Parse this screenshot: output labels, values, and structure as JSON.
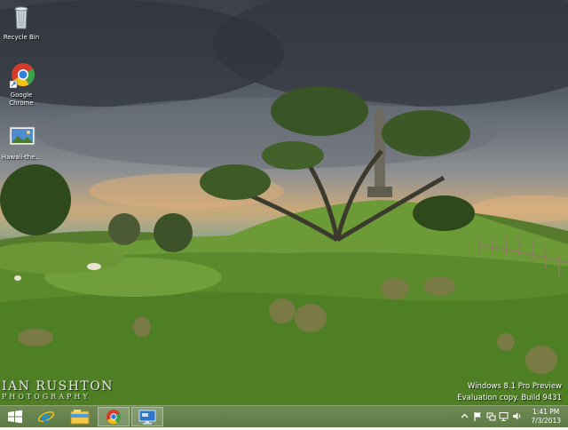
{
  "desktop": {
    "icons": [
      {
        "label": "Recycle Bin",
        "icon": "recycle-bin-icon"
      },
      {
        "label": "Google Chrome",
        "icon": "chrome-icon"
      },
      {
        "label": "Hawaii-the...",
        "icon": "image-file-icon"
      }
    ],
    "watermark": {
      "line1": "Windows 8.1 Pro Preview",
      "line2": "Evaluation copy. Build 9431"
    },
    "photographer": {
      "line1": "IAN RUSHTON",
      "line2": "PHOTOGRAPHY"
    }
  },
  "taskbar": {
    "buttons": [
      {
        "icon": "windows-start-icon"
      },
      {
        "icon": "internet-explorer-icon"
      },
      {
        "icon": "file-explorer-icon"
      },
      {
        "icon": "chrome-icon"
      },
      {
        "icon": "remote-desktop-icon"
      }
    ],
    "tray": [
      "chevron-up-icon",
      "flag-icon",
      "network-icon",
      "monitor-icon",
      "speaker-icon"
    ],
    "clock": {
      "time": "1:41 PM",
      "date": "7/3/2013"
    },
    "colors": {
      "taskbar": "#6b8650",
      "accent": "#1e90d6"
    }
  }
}
